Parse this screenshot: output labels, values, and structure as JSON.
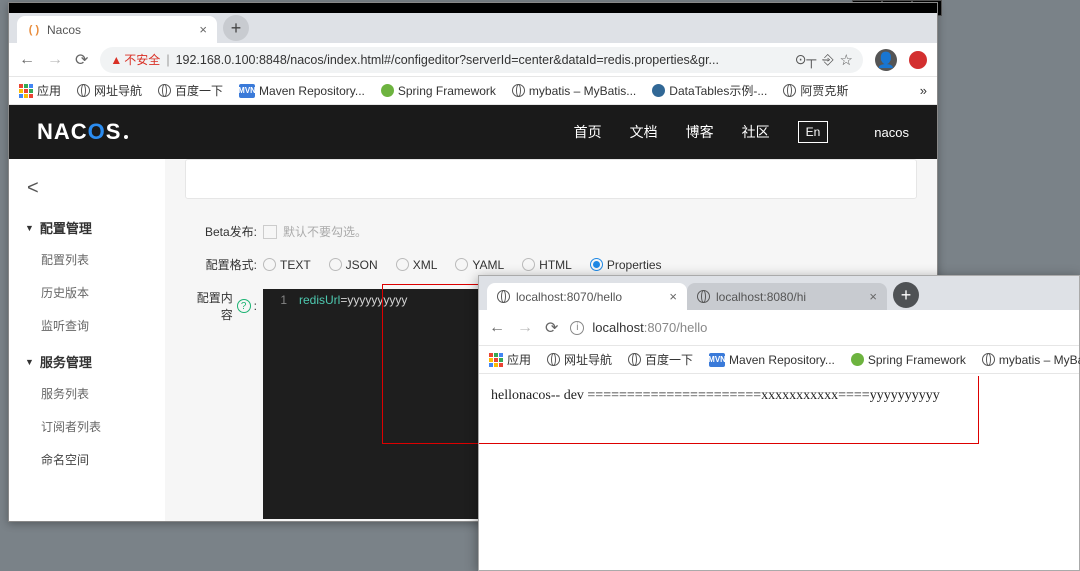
{
  "os_buttons": {
    "min": "–",
    "max": "❐",
    "close": "✕"
  },
  "win1": {
    "tab": {
      "title": "Nacos",
      "favicon": "( )"
    },
    "url_warn": "不安全",
    "url": "192.168.0.100:8848/nacos/index.html#/configeditor?serverId=center&dataId=redis.properties&gr...",
    "bookmarks": {
      "apps": "应用",
      "items": [
        "网址导航",
        "百度一下",
        "Maven Repository...",
        "Spring Framework",
        "mybatis – MyBatis...",
        "DataTables示例-...",
        "阿贾克斯"
      ]
    }
  },
  "nacos": {
    "logo_parts": {
      "p1": "NAC",
      "p2": "O",
      "p3": "S"
    },
    "nav": [
      "首页",
      "文档",
      "博客",
      "社区"
    ],
    "lang": "En",
    "user": "nacos",
    "sidebar": {
      "cat1": "配置管理",
      "cat1_items": [
        "配置列表",
        "历史版本",
        "监听查询"
      ],
      "cat2": "服务管理",
      "cat2_items": [
        "服务列表",
        "订阅者列表"
      ],
      "namespace": "命名空间"
    },
    "form": {
      "beta_label": "Beta发布:",
      "beta_hint": "默认不要勾选。",
      "format_label": "配置格式:",
      "formats": [
        "TEXT",
        "JSON",
        "XML",
        "YAML",
        "HTML",
        "Properties"
      ],
      "format_selected": 5,
      "content_label": "配置内容",
      "help": "?"
    },
    "editor": {
      "line_no": "1",
      "key": "redisUrl",
      "eq": "=",
      "val": "yyyyyyyyyy"
    }
  },
  "win2": {
    "tabs": [
      {
        "title": "localhost:8070/hello",
        "active": true
      },
      {
        "title": "localhost:8080/hi",
        "active": false
      }
    ],
    "url_host": "localhost",
    "url_path": ":8070/hello",
    "bookmarks": {
      "apps": "应用",
      "items": [
        "网址导航",
        "百度一下",
        "Maven Repository...",
        "Spring Framework",
        "mybatis – MyBatis..."
      ]
    },
    "body": "hellonacos-- dev ======================xxxxxxxxxxx====yyyyyyyyyy"
  }
}
